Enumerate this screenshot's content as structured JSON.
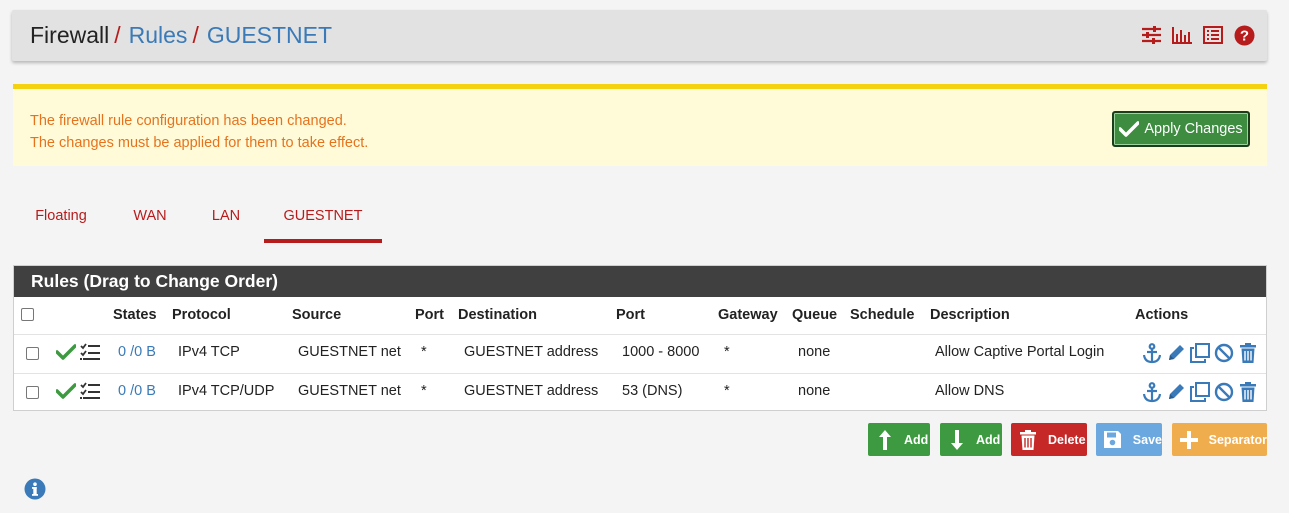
{
  "breadcrumb": {
    "section": "Firewall",
    "page": "Rules",
    "current": "GUESTNET",
    "separator": "/"
  },
  "header_icons": [
    "sliders-icon",
    "bar-chart-icon",
    "list-icon",
    "help-icon"
  ],
  "alert": {
    "line1": "The firewall rule configuration has been changed.",
    "line2": "The changes must be applied for them to take effect.",
    "apply_label": "Apply Changes"
  },
  "tabs": [
    {
      "label": "Floating",
      "active": false
    },
    {
      "label": "WAN",
      "active": false
    },
    {
      "label": "LAN",
      "active": false
    },
    {
      "label": "GUESTNET",
      "active": true
    }
  ],
  "rules_panel": {
    "title": "Rules (Drag to Change Order)",
    "columns": {
      "states": "States",
      "protocol": "Protocol",
      "source": "Source",
      "source_port": "Port",
      "destination": "Destination",
      "dest_port": "Port",
      "gateway": "Gateway",
      "queue": "Queue",
      "schedule": "Schedule",
      "description": "Description",
      "actions": "Actions"
    },
    "rows": [
      {
        "states": "0 /0 B",
        "protocol": "IPv4 TCP",
        "source": "GUESTNET net",
        "source_port": "*",
        "destination": "GUESTNET address",
        "dest_port": "1000 - 8000",
        "gateway": "*",
        "queue": "none",
        "schedule": "",
        "description": "Allow Captive Portal Login"
      },
      {
        "states": "0 /0 B",
        "protocol": "IPv4 TCP/UDP",
        "source": "GUESTNET net",
        "source_port": "*",
        "destination": "GUESTNET address",
        "dest_port": "53 (DNS)",
        "gateway": "*",
        "queue": "none",
        "schedule": "",
        "description": "Allow DNS"
      }
    ]
  },
  "buttons": {
    "add_top": "Add",
    "add_bottom": "Add",
    "delete": "Delete",
    "save": "Save",
    "separator": "Separator"
  },
  "colors": {
    "accent_red": "#b71c1c",
    "link_blue": "#3a7ab8",
    "success_green": "#3d9a40",
    "danger_red": "#c62828",
    "save_blue": "#6aa8df",
    "warning_orange": "#f0ad4e",
    "alert_text": "#e5731d"
  }
}
